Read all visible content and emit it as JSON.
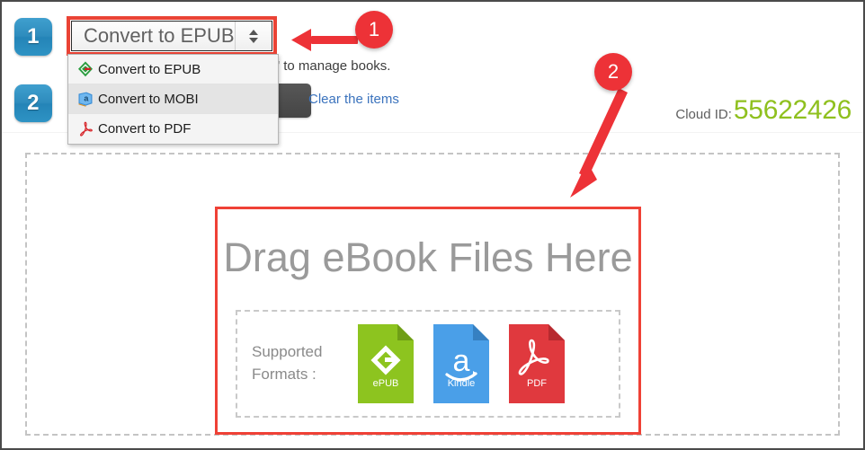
{
  "steps": [
    {
      "number": "1"
    },
    {
      "number": "2"
    }
  ],
  "toolbar": {
    "select": {
      "selected_label": "Convert to EPUB",
      "arrows_icon": "up-down-arrows-icon"
    },
    "dropdown_options": [
      {
        "label": "Convert to EPUB",
        "icon": "epub-logo-icon",
        "hovered": false
      },
      {
        "label": "Convert to MOBI",
        "icon": "mobi-book-icon",
        "hovered": true
      },
      {
        "label": "Convert to PDF",
        "icon": "pdf-acrobat-icon",
        "hovered": false
      }
    ],
    "description": "Download URLs, click \"Cloud ID\" to manage books.",
    "clear_link": "Clear the items",
    "cloud_id_label": "Cloud ID:",
    "cloud_id_value": "55622426"
  },
  "dropzone": {
    "title": "Drag eBook Files Here",
    "formats_label": "Supported\nFormats :",
    "formats": [
      {
        "caption": "ePUB",
        "color": "#8dc41f",
        "fold_color": "#6f9e16",
        "icon": "epub-file-icon"
      },
      {
        "caption": "Kindle",
        "color": "#4a9fe8",
        "fold_color": "#3680c1",
        "icon": "kindle-file-icon"
      },
      {
        "caption": "PDF",
        "color": "#e0393e",
        "fold_color": "#b72a2f",
        "icon": "pdf-file-icon"
      }
    ]
  },
  "callouts": [
    {
      "number": "1"
    },
    {
      "number": "2"
    }
  ],
  "colors": {
    "accent_red": "#ed3237",
    "badge_blue": "#2e8cbd",
    "cloud_id_green": "#8fc01e",
    "link_blue": "#3b73bd"
  }
}
